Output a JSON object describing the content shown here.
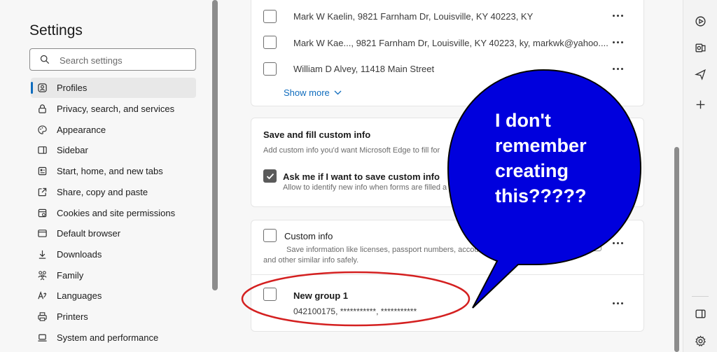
{
  "nav": {
    "title": "Settings",
    "search_placeholder": "Search settings",
    "items": [
      {
        "label": "Profiles",
        "icon": "profile-icon",
        "active": true
      },
      {
        "label": "Privacy, search, and services",
        "icon": "lock-icon"
      },
      {
        "label": "Appearance",
        "icon": "palette-icon"
      },
      {
        "label": "Sidebar",
        "icon": "sidebar-icon"
      },
      {
        "label": "Start, home, and new tabs",
        "icon": "home-icon"
      },
      {
        "label": "Share, copy and paste",
        "icon": "share-icon"
      },
      {
        "label": "Cookies and site permissions",
        "icon": "cookie-icon"
      },
      {
        "label": "Default browser",
        "icon": "browser-icon"
      },
      {
        "label": "Downloads",
        "icon": "download-icon"
      },
      {
        "label": "Family",
        "icon": "family-icon"
      },
      {
        "label": "Languages",
        "icon": "language-icon"
      },
      {
        "label": "Printers",
        "icon": "printer-icon"
      },
      {
        "label": "System and performance",
        "icon": "laptop-icon"
      }
    ]
  },
  "addresses": {
    "rows": [
      "Mark W Kaelin, 9821 Farnham Dr, Louisville, KY 40223, KY",
      "Mark W Kae..., 9821 Farnham Dr, Louisville, KY 40223, ky, markwk@yahoo....",
      "William D Alvey, 11418 Main Street"
    ],
    "show_more": "Show more"
  },
  "custom_info_section": {
    "title": "Save and fill custom info",
    "description": "Add custom info you'd want Microsoft Edge to fill for",
    "ask_label": "Ask me if I want to save custom info",
    "ask_desc": "Allow to identify new info when forms are filled a"
  },
  "custom_info_card": {
    "title": "Custom info",
    "description_line1": "Save information like licenses, passport numbers, account n",
    "description_line2": "and other similar info safely.",
    "group_title": "New group 1",
    "group_value": "042100175, ***********, ***********"
  },
  "annotation": {
    "lines": [
      "I don't",
      "remember",
      "creating",
      "this?????"
    ],
    "bubble_color": "#0000dd",
    "ellipse_color": "#d42020"
  },
  "colors": {
    "accent": "#0f6cbd",
    "checkbox_checked": "#5a5a5a"
  }
}
